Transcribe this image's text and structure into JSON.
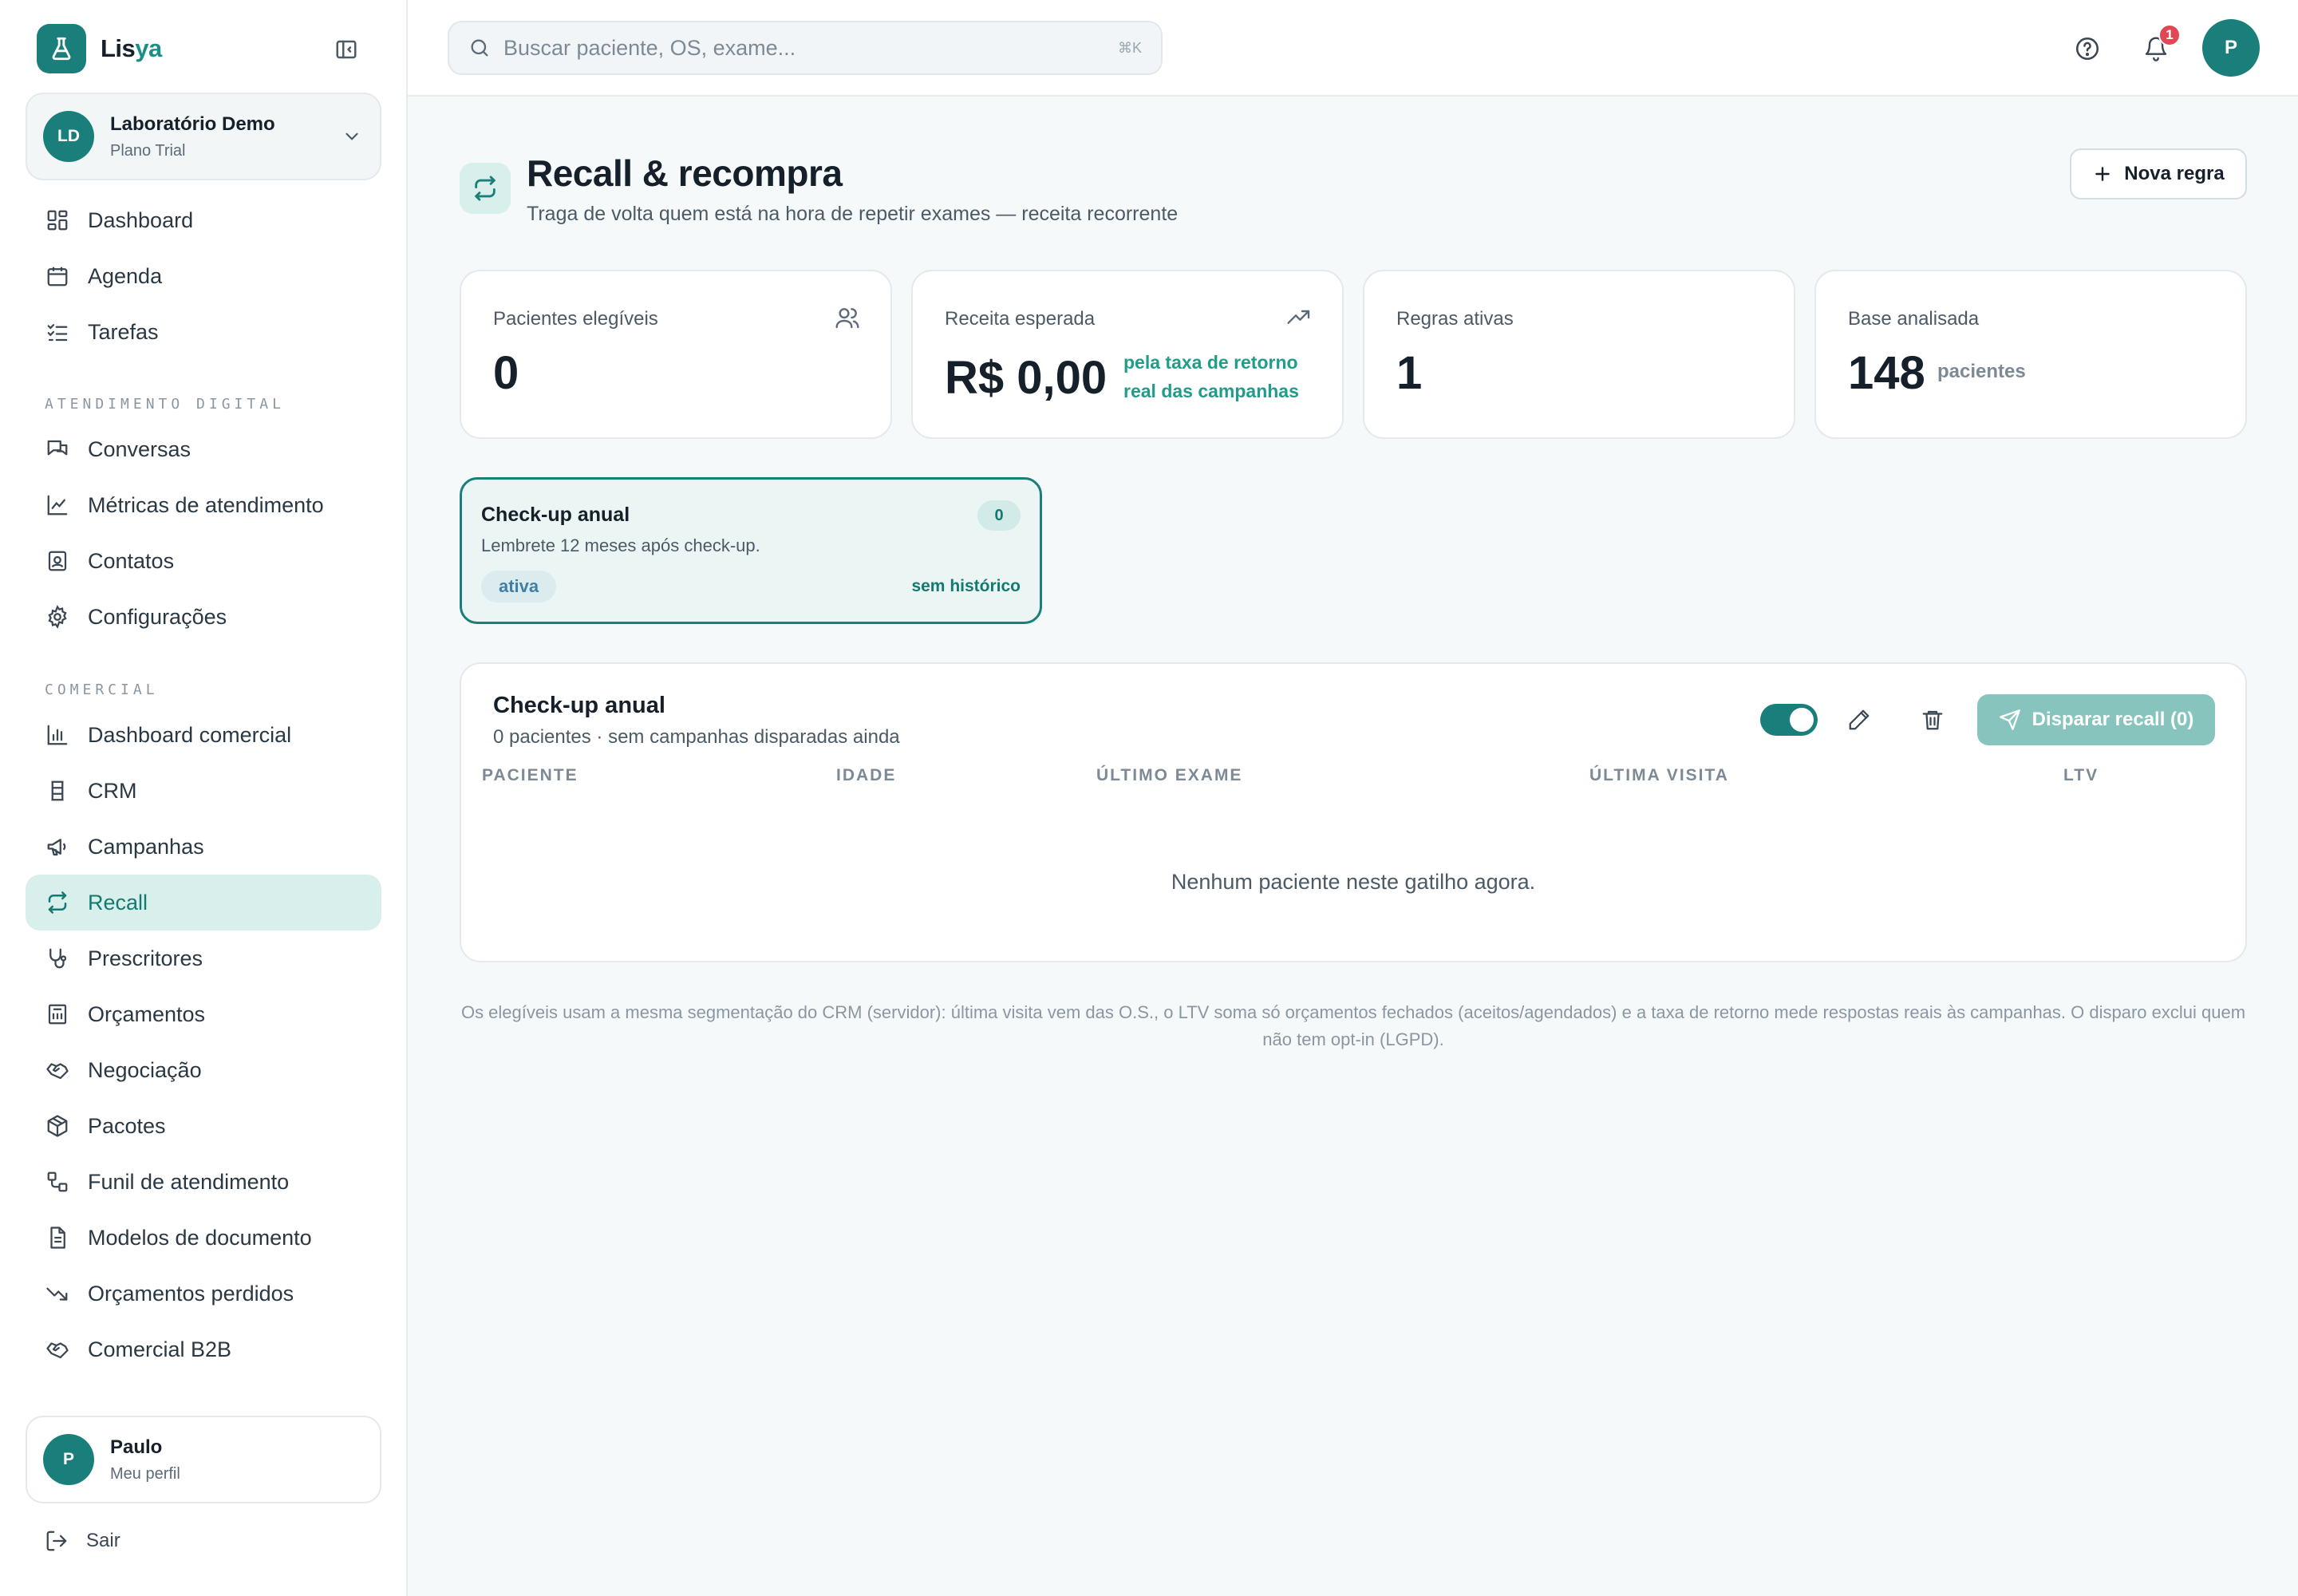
{
  "brand": {
    "name_main": "Lis",
    "name_accent": "ya"
  },
  "org": {
    "initials": "LD",
    "name": "Laboratório Demo",
    "plan": "Plano Trial"
  },
  "nav_main": [
    {
      "label": "Dashboard",
      "icon": "dashboard-icon"
    },
    {
      "label": "Agenda",
      "icon": "calendar-icon"
    },
    {
      "label": "Tarefas",
      "icon": "checklist-icon"
    }
  ],
  "sections": {
    "digital": "ATENDIMENTO DIGITAL",
    "comercial": "COMERCIAL"
  },
  "nav_digital": [
    {
      "label": "Conversas",
      "icon": "chat-icon"
    },
    {
      "label": "Métricas de atendimento",
      "icon": "line-chart-icon"
    },
    {
      "label": "Contatos",
      "icon": "contact-icon"
    },
    {
      "label": "Configurações",
      "icon": "gear-icon"
    }
  ],
  "nav_comercial": [
    {
      "label": "Dashboard comercial",
      "icon": "bar-chart-icon"
    },
    {
      "label": "CRM",
      "icon": "crm-icon"
    },
    {
      "label": "Campanhas",
      "icon": "megaphone-icon"
    },
    {
      "label": "Recall",
      "icon": "repeat-icon",
      "active": true
    },
    {
      "label": "Prescritores",
      "icon": "stethoscope-icon"
    },
    {
      "label": "Orçamentos",
      "icon": "budget-icon"
    },
    {
      "label": "Negociação",
      "icon": "handshake-icon"
    },
    {
      "label": "Pacotes",
      "icon": "package-icon"
    },
    {
      "label": "Funil de atendimento",
      "icon": "workflow-icon"
    },
    {
      "label": "Modelos de documento",
      "icon": "document-icon"
    },
    {
      "label": "Orçamentos perdidos",
      "icon": "trending-down-icon"
    },
    {
      "label": "Comercial B2B",
      "icon": "handshake-icon"
    }
  ],
  "user": {
    "initial": "P",
    "name": "Paulo",
    "subtitle": "Meu perfil"
  },
  "logout_label": "Sair",
  "search": {
    "placeholder": "Buscar paciente, OS, exame...",
    "shortcut": "⌘K"
  },
  "topbar": {
    "notifications": "1",
    "avatar_initial": "P"
  },
  "page": {
    "title": "Recall & recompra",
    "subtitle": "Traga de volta quem está na hora de repetir exames — receita recorrente",
    "new_rule_label": "Nova regra"
  },
  "stats": {
    "eligible": {
      "label": "Pacientes elegíveis",
      "value": "0"
    },
    "revenue": {
      "label": "Receita esperada",
      "value": "R$ 0,00",
      "note": "pela taxa de retorno real das campanhas"
    },
    "rules": {
      "label": "Regras ativas",
      "value": "1"
    },
    "base": {
      "label": "Base analisada",
      "value": "148",
      "unit": "pacientes"
    }
  },
  "rule_card": {
    "title": "Check-up anual",
    "count": "0",
    "description": "Lembrete 12 meses após check-up.",
    "status": "ativa",
    "history": "sem histórico"
  },
  "detail": {
    "title": "Check-up anual",
    "subtitle": "0 pacientes · sem campanhas disparadas ainda",
    "fire_label": "Disparar recall (0)",
    "columns": [
      "PACIENTE",
      "IDADE",
      "ÚLTIMO EXAME",
      "ÚLTIMA VISITA",
      "LTV"
    ],
    "empty": "Nenhum paciente neste gatilho agora."
  },
  "footnote": "Os elegíveis usam a mesma segmentação do CRM (servidor): última visita vem das O.S., o LTV soma só orçamentos fechados (aceitos/agendados) e a taxa de retorno mede respostas reais às campanhas. O disparo exclui quem não tem opt-in (LGPD).",
  "colors": {
    "primary": "#1a7f7a",
    "accent_text": "#1f9d8a",
    "active_bg": "#d9efec",
    "badge": "#e04856"
  }
}
